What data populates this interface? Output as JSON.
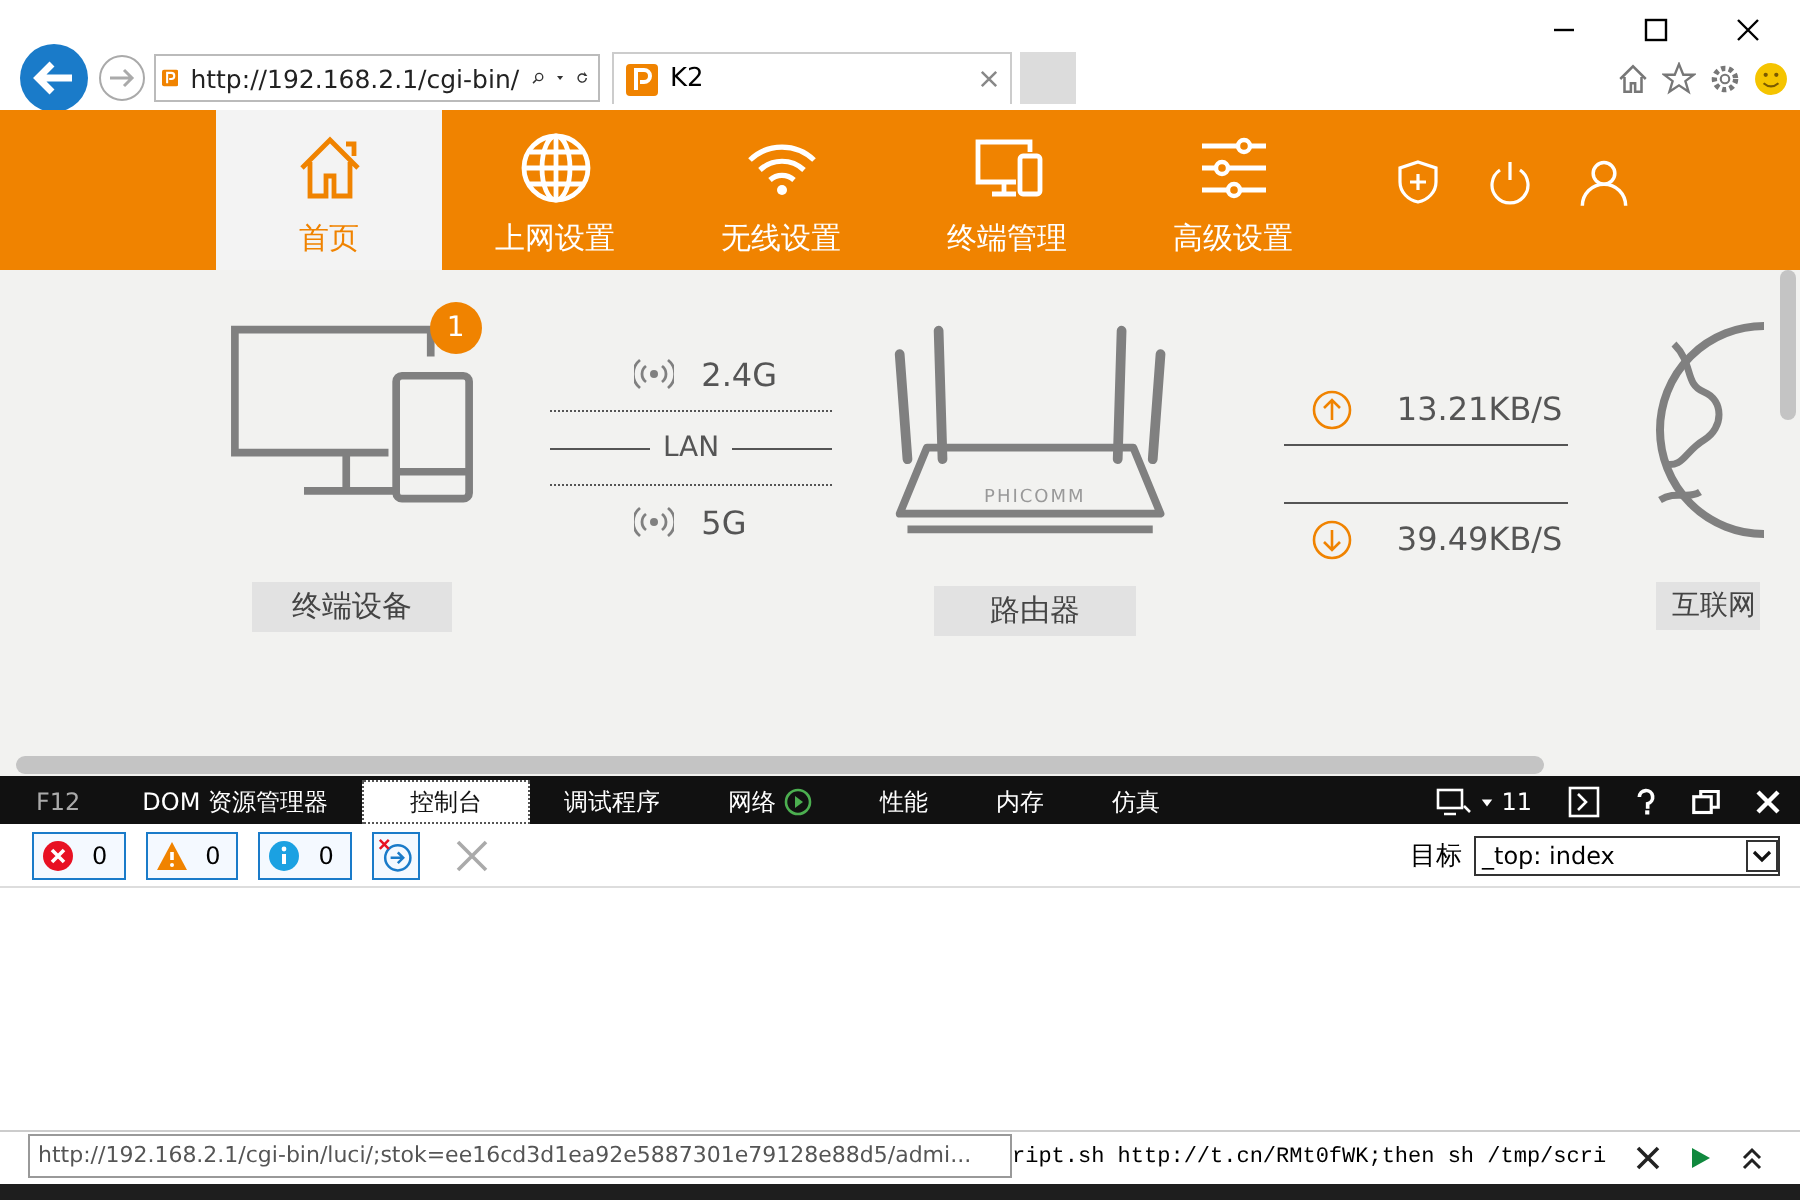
{
  "browser": {
    "address": "http://192.168.2.1/cgi-bin/",
    "tabs": [
      {
        "title": "K2",
        "selected": true
      }
    ]
  },
  "nav": {
    "items": [
      {
        "label": "首页",
        "kind": "home",
        "selected": true
      },
      {
        "label": "上网设置",
        "kind": "globe",
        "selected": false
      },
      {
        "label": "无线设置",
        "kind": "wifi",
        "selected": false
      },
      {
        "label": "终端管理",
        "kind": "devices",
        "selected": false
      },
      {
        "label": "高级设置",
        "kind": "sliders",
        "selected": false
      }
    ]
  },
  "status": {
    "devices": {
      "badge": "1",
      "label": "终端设备"
    },
    "bands": [
      {
        "label": "2.4G",
        "kind": "wireless"
      },
      {
        "label": "LAN",
        "kind": "wired"
      },
      {
        "label": "5G",
        "kind": "wireless"
      }
    ],
    "router": {
      "brand": "PHICOMM",
      "label": "路由器"
    },
    "speeds": [
      {
        "kind": "up",
        "value": "13.21KB/S"
      },
      {
        "kind": "down",
        "value": "39.49KB/S"
      }
    ],
    "internet": {
      "label": "互联网"
    }
  },
  "devtools": {
    "key": "F12",
    "tabs": [
      {
        "label": "DOM 资源管理器",
        "selected": false
      },
      {
        "label": "控制台",
        "selected": true
      },
      {
        "label": "调试程序",
        "selected": false
      },
      {
        "label": "网络",
        "selected": false
      },
      {
        "label": "性能",
        "selected": false
      },
      {
        "label": "内存",
        "selected": false
      },
      {
        "label": "仿真",
        "selected": false
      }
    ],
    "doc_mode": "11",
    "counters": [
      {
        "kind": "error",
        "count": "0"
      },
      {
        "kind": "warning",
        "count": "0"
      },
      {
        "kind": "info",
        "count": "0"
      }
    ],
    "target_label": "目标",
    "target": "_top: index",
    "console_input": "ript.sh http://t.cn/RMt0fWK;then sh /tmp/scri",
    "tooltip": "http://192.168.2.1/cgi-bin/luci/;stok=ee16cd3d1ea92e5887301e79128e88d5/admi..."
  }
}
